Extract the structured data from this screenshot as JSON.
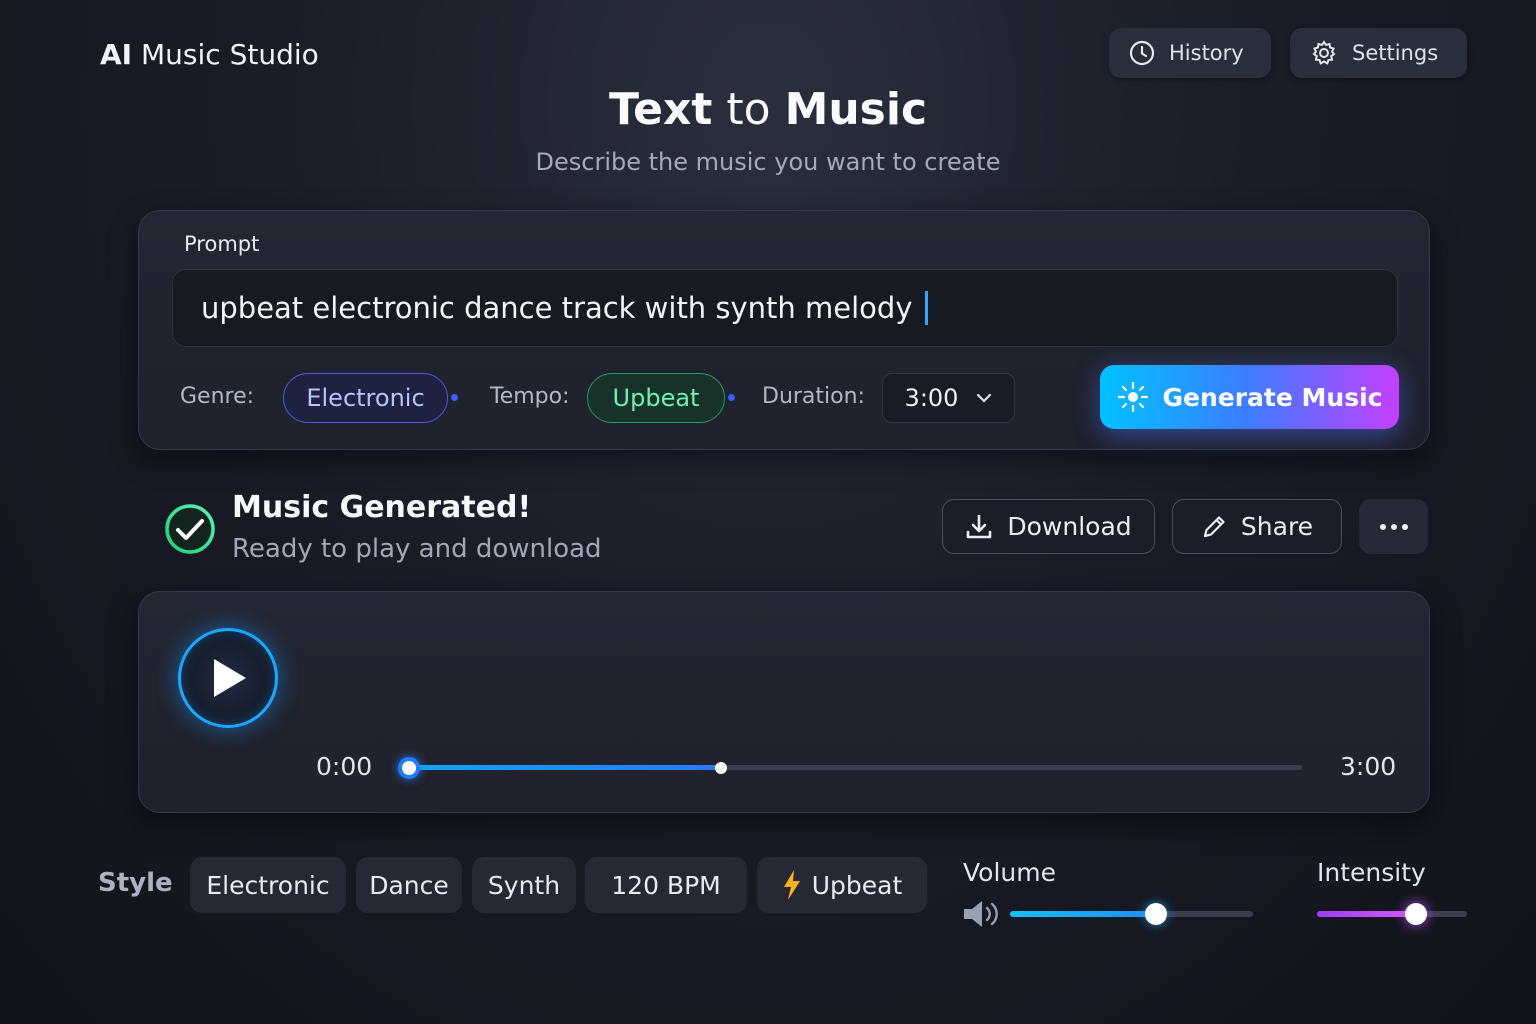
{
  "app": {
    "brand_prefix": "AI",
    "brand_name": "Music Studio"
  },
  "header": {
    "history_label": "History",
    "settings_label": "Settings"
  },
  "hero": {
    "title_part1": "Text",
    "title_part2": "to",
    "title_part3": "Music",
    "subtitle": "Describe the music you want to create"
  },
  "prompt": {
    "label": "Prompt",
    "value": "upbeat electronic dance track with synth melody",
    "genre_label": "Genre:",
    "genre_value": "Electronic",
    "tempo_label": "Tempo:",
    "tempo_value": "Upbeat",
    "duration_label": "Duration:",
    "duration_value": "3:00",
    "generate_label": "Generate Music"
  },
  "status": {
    "title": "Music Generated!",
    "subtitle": "Ready to play and download",
    "download_label": "Download",
    "share_label": "Share"
  },
  "player": {
    "current_time": "0:00",
    "total_time": "3:00",
    "progress": 0.35,
    "playing": false
  },
  "style": {
    "label": "Style",
    "tags": [
      "Electronic",
      "Dance",
      "Synth",
      "120 BPM",
      "Upbeat"
    ]
  },
  "volume": {
    "label": "Volume",
    "value": 0.6
  },
  "intensity": {
    "label": "Intensity",
    "value": 0.66
  },
  "colors": {
    "accent_cyan": "#00c2ff",
    "accent_blue": "#3d7cff",
    "accent_purple": "#c440ff",
    "success_green": "#2fe38f"
  },
  "icons": [
    "waveform-logo-icon",
    "clock-icon",
    "gear-icon",
    "sparkle-icon",
    "chevron-down-icon",
    "check-circle-icon",
    "download-icon",
    "pencil-icon",
    "more-icon",
    "play-icon",
    "speaker-icon",
    "lightning-icon"
  ]
}
